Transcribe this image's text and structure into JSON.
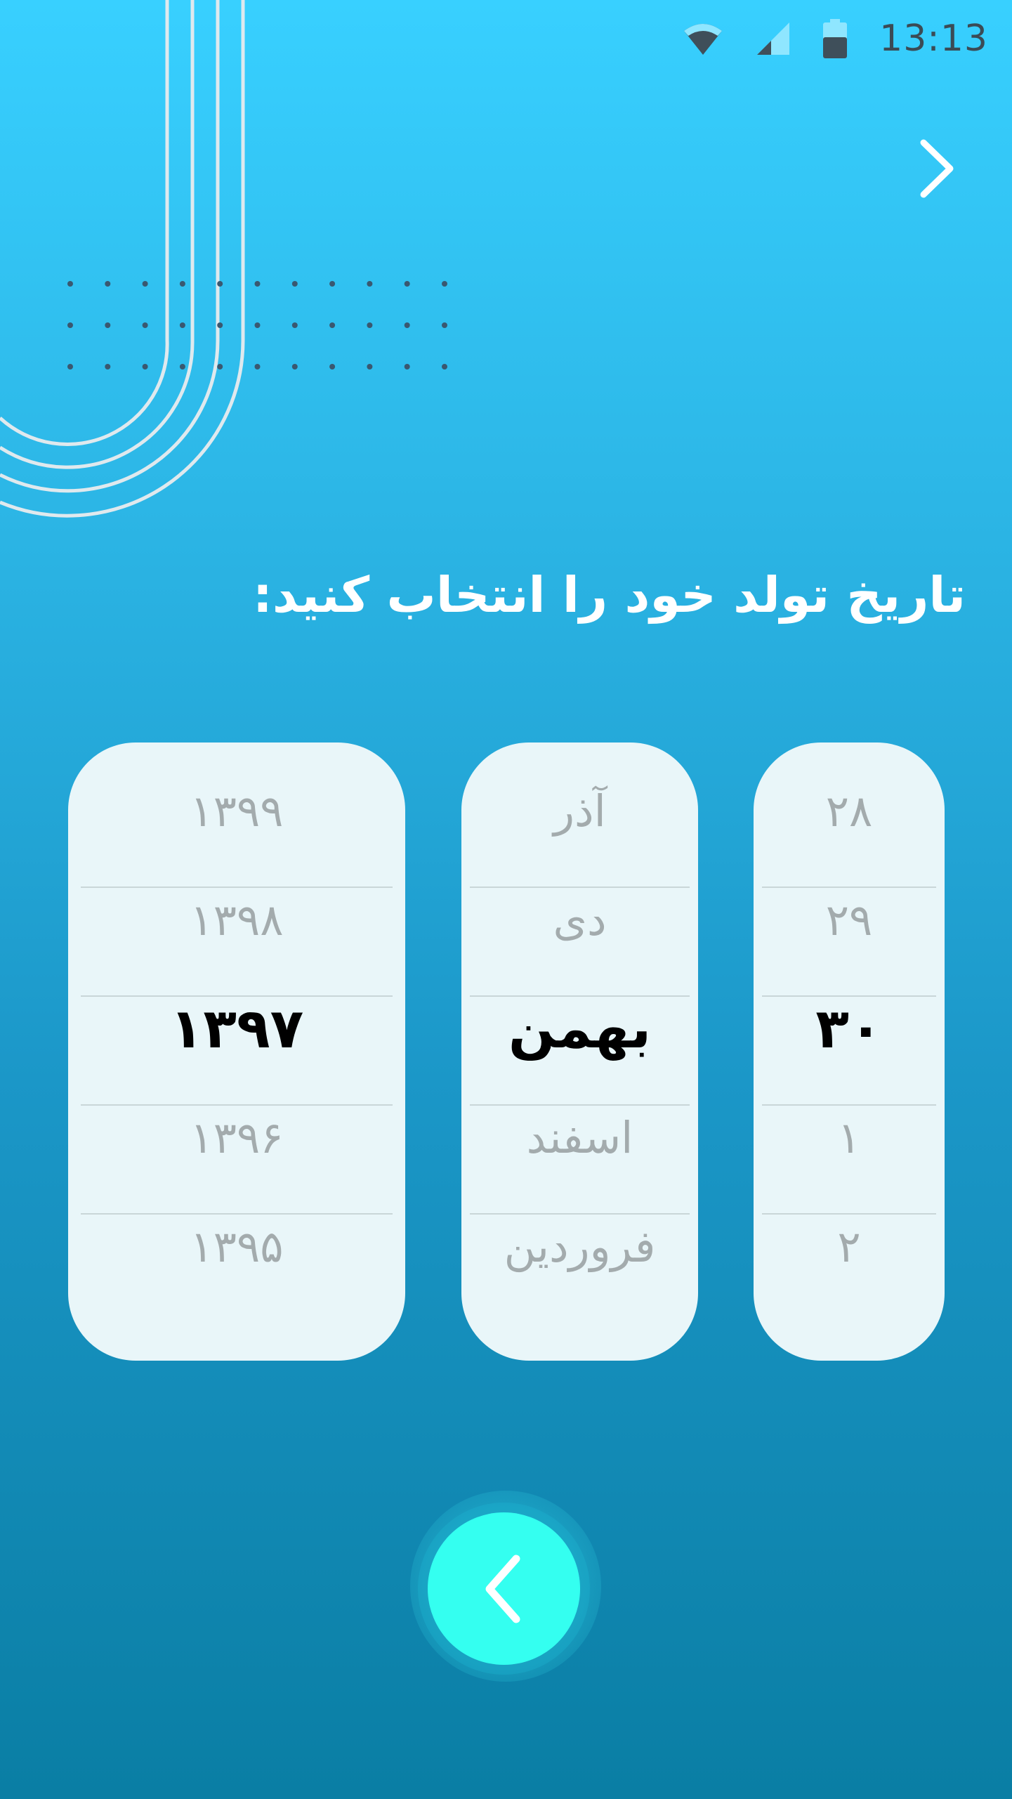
{
  "status_bar": {
    "time": "13:13",
    "wifi_icon": "wifi-icon",
    "signal_icon": "signal-icon",
    "battery_icon": "battery-icon"
  },
  "header": {
    "forward_icon": "chevron-right-icon"
  },
  "title": "تاریخ تولد خود را انتخاب کنید:",
  "pickers": {
    "day": {
      "items": [
        "۲۸",
        "۲۹",
        "۳۰",
        "۱",
        "۲"
      ],
      "selected_index": 2
    },
    "month": {
      "items": [
        "آذر",
        "دی",
        "بهمن",
        "اسفند",
        "فروردین"
      ],
      "selected_index": 2
    },
    "year": {
      "items": [
        "۱۳۹۹",
        "۱۳۹۸",
        "۱۳۹۷",
        "۱۳۹۶",
        "۱۳۹۵"
      ],
      "selected_index": 2
    }
  },
  "footer": {
    "back_icon": "chevron-left-icon"
  },
  "colors": {
    "background_top": "#38d0ff",
    "background_bottom": "#0a7ea4",
    "picker_bg": "#e9f6f9",
    "button_accent": "#34fff0",
    "selected_text": "#000000",
    "unselected_text": "#a3abad"
  }
}
